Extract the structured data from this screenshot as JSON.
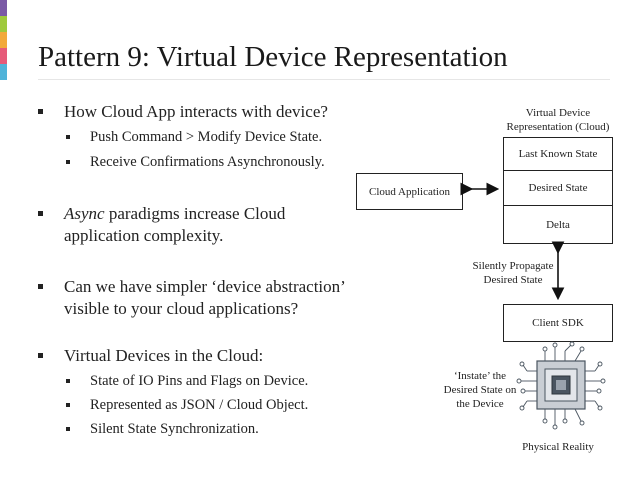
{
  "slide": {
    "title": "Pattern 9: Virtual Device Representation",
    "accent_colors": [
      "#7b5aa6",
      "#9fc93c",
      "#f2a93b",
      "#e65b79",
      "#4fb3d9"
    ]
  },
  "bullets": [
    {
      "text": "How Cloud App interacts with device?",
      "subs": [
        "Push Command > Modify Device State.",
        "Receive Confirmations Asynchronously."
      ]
    },
    {
      "text_italic": "Async",
      "text_rest": " paradigms increase Cloud",
      "text_line2": "application complexity."
    },
    {
      "text": "Can we have simpler ‘device abstraction’",
      "text_line2": "visible to your cloud applications?"
    },
    {
      "text": "Virtual Devices in the Cloud:",
      "subs": [
        "State of IO Pins and Flags on Device.",
        "Represented as JSON / Cloud Object.",
        "Silent State Synchronization."
      ]
    }
  ],
  "diagram": {
    "vdr_title_line1": "Virtual Device",
    "vdr_title_line2": "Representation (Cloud)",
    "stack": [
      "Last Known State",
      "Desired State",
      "Delta"
    ],
    "cloud_app": "Cloud Application",
    "propagate_line1": "Silently Propagate",
    "propagate_line2": "Desired State",
    "client_sdk": "Client SDK",
    "instate_line1": "‘Instate’ the",
    "instate_line2": "Desired State on",
    "instate_line3": "the Device",
    "physical": "Physical Reality",
    "chip_icon": "microchip-icon"
  }
}
